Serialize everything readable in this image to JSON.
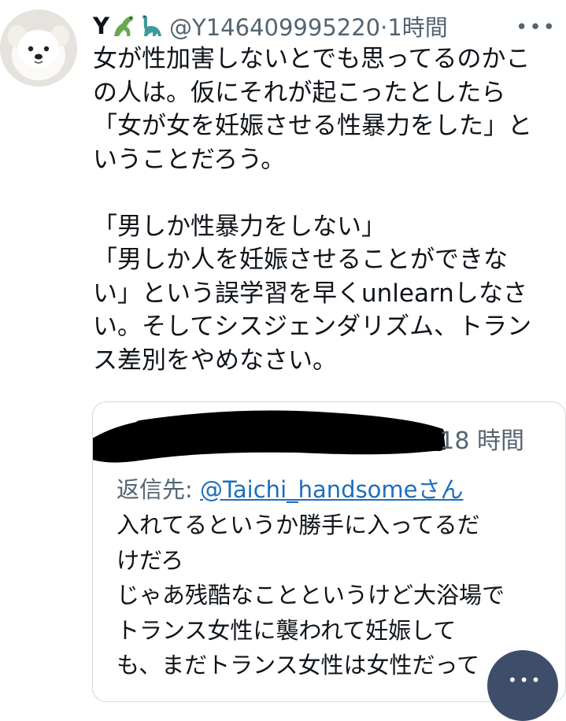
{
  "tweet": {
    "display_name": "Y",
    "emoji_icons": [
      "lizard-icon",
      "sauropod-icon"
    ],
    "handle_time": "@Y146409995220·1時間",
    "more_label": "•••",
    "body": "女が性加害しないとでも思ってるのかこ\nの人は。仮にそれが起こったとしたら\n「女が女を妊娠させる性暴力をした」と\nいうことだろう。\n\n「男しか性暴力をしない」\n「男しか人を妊娠させることができな\nい」という誤学習を早くunlearnしなさ\nい。そしてシスジェンダリズム、トラン\nス差別をやめなさい。"
  },
  "quote": {
    "time": "18 時間",
    "reply_prefix": "返信先: ",
    "reply_handle": "@Taichi_handsome",
    "reply_suffix": "さん",
    "body": "入れてるというか勝手に入ってるだ\nけだろ\nじゃあ残酷なことというけど大浴場で\nトランス女性に襲われて妊娠して\nも、まだトランス女性は女性だって"
  },
  "colors": {
    "text": "#0f1419",
    "secondary": "#536471",
    "link": "#1d6fb8",
    "border": "#cfd9de"
  }
}
